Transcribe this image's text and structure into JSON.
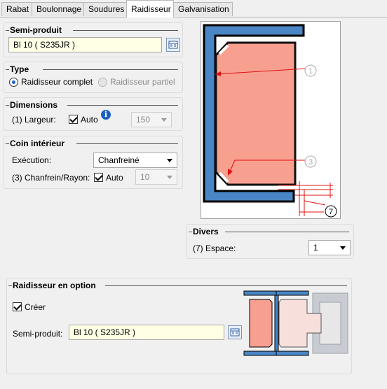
{
  "tabs": [
    {
      "label": "Rabat"
    },
    {
      "label": "Boulonnage"
    },
    {
      "label": "Soudures"
    },
    {
      "label": "Raidisseur",
      "active": true
    },
    {
      "label": "Galvanisation"
    }
  ],
  "semi_produit": {
    "title": "Semi-produit",
    "value": "Bl 10  ( S235JR )"
  },
  "type": {
    "title": "Type",
    "option1": "Raidisseur complet",
    "option2": "Raidisseur partiel",
    "selected": "option1"
  },
  "dimensions": {
    "title": "Dimensions",
    "label": "(1) Largeur:",
    "auto_label": "Auto",
    "auto_checked": true,
    "value": "150"
  },
  "coin": {
    "title": "Coin intérieur",
    "execution_label": "Exécution:",
    "execution_value": "Chanfreiné",
    "chanfrein_label": "(3) Chanfrein/Rayon:",
    "auto_label": "Auto",
    "auto_checked": true,
    "value": "10"
  },
  "drawing": {
    "label1": "1",
    "label3": "3",
    "label7": "7"
  },
  "divers": {
    "title": "Divers",
    "label": "(7) Espace:",
    "value": "1"
  },
  "optional": {
    "title": "Raidisseur en option",
    "create_label": "Créer",
    "create_checked": true,
    "semi_label": "Semi-produit:",
    "semi_value": "Bl 10  ( S235JR )"
  },
  "colors": {
    "steel": "#4a86c6",
    "plate": "#f7a090",
    "panel_bg": "#f0f0f0",
    "input_yellow": "#ffffe6"
  }
}
